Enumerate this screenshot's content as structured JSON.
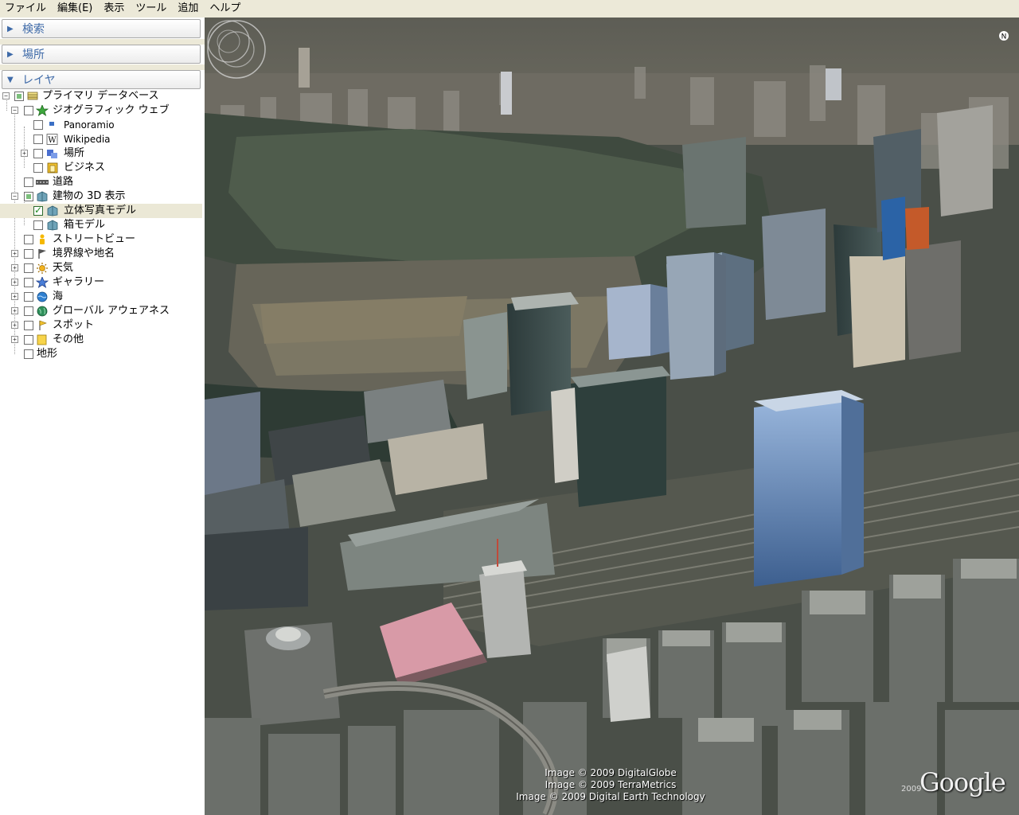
{
  "menubar": {
    "items": [
      "ファイル",
      "編集(E)",
      "表示",
      "ツール",
      "追加",
      "ヘルプ"
    ]
  },
  "sidebar": {
    "panels": {
      "search": "検索",
      "places": "場所",
      "layers": "レイヤ"
    },
    "layers": [
      {
        "label": "プライマリ データベース",
        "state": "partial",
        "expander": "minus"
      },
      {
        "label": "ジオグラフィック ウェブ",
        "state": "unchecked",
        "expander": "minus"
      },
      {
        "label": "Panoramio",
        "state": "unchecked",
        "expander": "none"
      },
      {
        "label": "Wikipedia",
        "state": "unchecked",
        "expander": "none"
      },
      {
        "label": "場所",
        "state": "unchecked",
        "expander": "plus"
      },
      {
        "label": "ビジネス",
        "state": "unchecked",
        "expander": "none"
      },
      {
        "label": "道路",
        "state": "unchecked",
        "expander": "none"
      },
      {
        "label": "建物の 3D 表示",
        "state": "partial",
        "expander": "minus"
      },
      {
        "label": "立体写真モデル",
        "state": "checked",
        "expander": "none"
      },
      {
        "label": "箱モデル",
        "state": "unchecked",
        "expander": "none"
      },
      {
        "label": "ストリートビュー",
        "state": "unchecked",
        "expander": "none"
      },
      {
        "label": "境界線や地名",
        "state": "unchecked",
        "expander": "plus"
      },
      {
        "label": "天気",
        "state": "unchecked",
        "expander": "plus"
      },
      {
        "label": "ギャラリー",
        "state": "unchecked",
        "expander": "plus"
      },
      {
        "label": "海",
        "state": "unchecked",
        "expander": "plus"
      },
      {
        "label": "グローバル アウェアネス",
        "state": "unchecked",
        "expander": "plus"
      },
      {
        "label": "スポット",
        "state": "unchecked",
        "expander": "plus"
      },
      {
        "label": "その他",
        "state": "unchecked",
        "expander": "plus"
      },
      {
        "label": "地形",
        "state": "unchecked",
        "expander": "none"
      }
    ]
  },
  "view": {
    "attribution": [
      "Image © 2009 DigitalGlobe",
      "Image © 2009 TerraMetrics",
      "Image © 2009 Digital Earth Technology"
    ],
    "logo": "Google",
    "logo_year": "2009"
  },
  "colors": {
    "panel_header_text": "#3e6aa8",
    "menubar_bg": "#ece9d8",
    "selected_row": "#ebe8d6",
    "checkbox_check": "#1e8a1e"
  }
}
